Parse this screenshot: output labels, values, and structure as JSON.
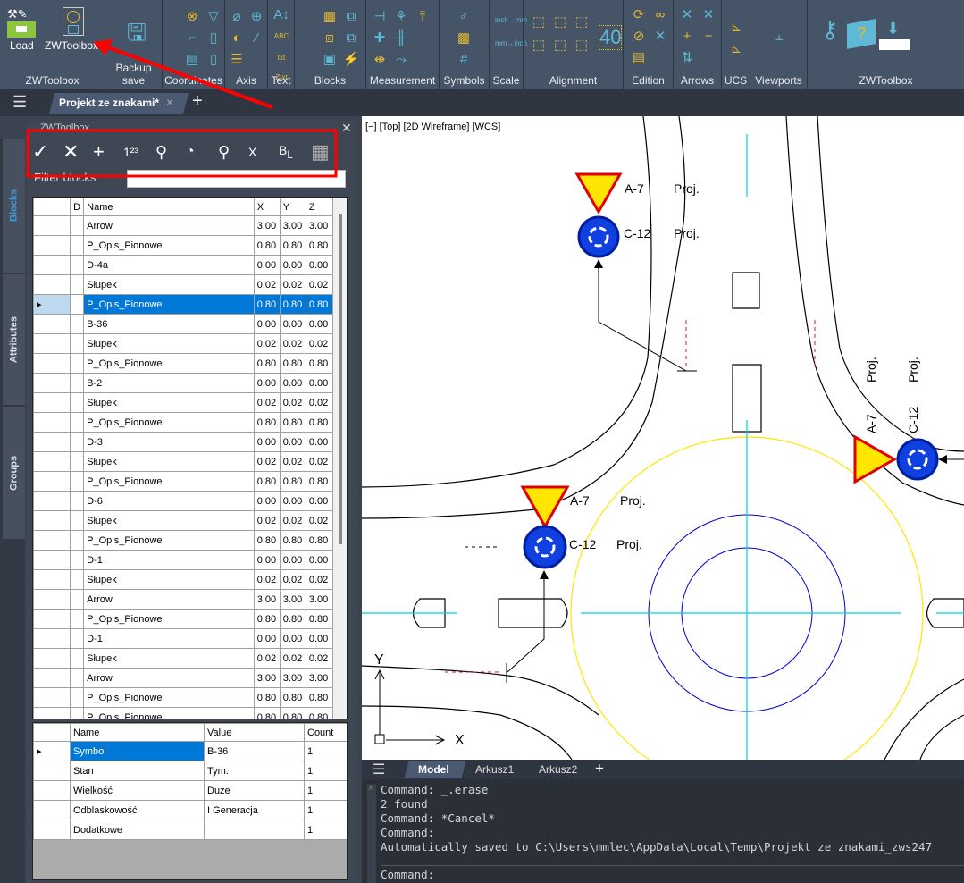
{
  "ribbon": {
    "groups": [
      {
        "label": "ZWToolbox",
        "buttons": [
          "Load",
          "ZWToolbox"
        ]
      },
      {
        "label": "Backup save"
      },
      {
        "label": "Coordinates"
      },
      {
        "label": "Axis"
      },
      {
        "label": "Text"
      },
      {
        "label": "Blocks"
      },
      {
        "label": "Measurement"
      },
      {
        "label": "Symbols"
      },
      {
        "label": "Scale"
      },
      {
        "label": "Alignment"
      },
      {
        "label": "Edition"
      },
      {
        "label": "Arrows"
      },
      {
        "label": "UCS"
      },
      {
        "label": "Viewports"
      },
      {
        "label": "ZWToolbox"
      }
    ],
    "scale_icons": [
      "inch→mm",
      "mm→inch"
    ],
    "text_icons": [
      "ABC",
      "txt Ztxt"
    ],
    "alignment_number": "40"
  },
  "tabs": {
    "document": "Projekt ze znakami*",
    "close": "×",
    "add": "+"
  },
  "toolbox": {
    "title": "ZWToolbox",
    "side_tabs": [
      "Blocks",
      "Attributes",
      "Groups"
    ],
    "toolbar": [
      "check-icon",
      "close-icon",
      "plus-icon",
      "numbering-icon",
      "search-icon",
      "select-icon",
      "zoom-find-icon",
      "x-axis-icon",
      "block-layer-icon",
      "grid-icon"
    ],
    "numbering_label": "1²³",
    "filter_label": "Filter blocks",
    "filter_value": "",
    "blocks": {
      "columns": [
        "D",
        "Name",
        "X",
        "Y",
        "Z"
      ],
      "selected_index": 4,
      "rows": [
        [
          "Arrow",
          "3.00",
          "3.00",
          "3.00"
        ],
        [
          "P_Opis_Pionowe",
          "0.80",
          "0.80",
          "0.80"
        ],
        [
          "D-4a",
          "0.00",
          "0.00",
          "0.00"
        ],
        [
          "Słupek",
          "0.02",
          "0.02",
          "0.02"
        ],
        [
          "P_Opis_Pionowe",
          "0.80",
          "0.80",
          "0.80"
        ],
        [
          "B-36",
          "0.00",
          "0.00",
          "0.00"
        ],
        [
          "Słupek",
          "0.02",
          "0.02",
          "0.02"
        ],
        [
          "P_Opis_Pionowe",
          "0.80",
          "0.80",
          "0.80"
        ],
        [
          "B-2",
          "0.00",
          "0.00",
          "0.00"
        ],
        [
          "Słupek",
          "0.02",
          "0.02",
          "0.02"
        ],
        [
          "P_Opis_Pionowe",
          "0.80",
          "0.80",
          "0.80"
        ],
        [
          "D-3",
          "0.00",
          "0.00",
          "0.00"
        ],
        [
          "Słupek",
          "0.02",
          "0.02",
          "0.02"
        ],
        [
          "P_Opis_Pionowe",
          "0.80",
          "0.80",
          "0.80"
        ],
        [
          "D-6",
          "0.00",
          "0.00",
          "0.00"
        ],
        [
          "Słupek",
          "0.02",
          "0.02",
          "0.02"
        ],
        [
          "P_Opis_Pionowe",
          "0.80",
          "0.80",
          "0.80"
        ],
        [
          "D-1",
          "0.00",
          "0.00",
          "0.00"
        ],
        [
          "Słupek",
          "0.02",
          "0.02",
          "0.02"
        ],
        [
          "Arrow",
          "3.00",
          "3.00",
          "3.00"
        ],
        [
          "P_Opis_Pionowe",
          "0.80",
          "0.80",
          "0.80"
        ],
        [
          "D-1",
          "0.00",
          "0.00",
          "0.00"
        ],
        [
          "Słupek",
          "0.02",
          "0.02",
          "0.02"
        ],
        [
          "Arrow",
          "3.00",
          "3.00",
          "3.00"
        ],
        [
          "P_Opis_Pionowe",
          "0.80",
          "0.80",
          "0.80"
        ],
        [
          "P_Opis_Pionowe",
          "0.80",
          "0.80",
          "0.80"
        ]
      ]
    },
    "attributes": {
      "columns": [
        "Name",
        "Value",
        "Count"
      ],
      "selected_index": 0,
      "rows": [
        [
          "Symbol",
          "B-36",
          "1"
        ],
        [
          "Stan",
          "Tym.",
          "1"
        ],
        [
          "Wielkość",
          "Duże",
          "1"
        ],
        [
          "Odblaskowość",
          "I Generacja",
          "1"
        ],
        [
          "Dodatkowe",
          "",
          "1"
        ]
      ]
    }
  },
  "drawing": {
    "viewport_label": "[−] [Top] [2D Wireframe] [WCS]",
    "sign_a": "A-7",
    "sign_c": "C-12",
    "proj": "Proj.",
    "axis_x": "X",
    "axis_y": "Y"
  },
  "layout_tabs": [
    "Model",
    "Arkusz1",
    "Arkusz2"
  ],
  "command": {
    "lines": [
      "Command: _.erase",
      "2 found",
      "Command: *Cancel*",
      "Command:",
      "Automatically saved to C:\\Users\\mmlec\\AppData\\Local\\Temp\\Projekt ze znakami_zws247"
    ],
    "prompt": "Command:"
  },
  "colors": {
    "ribbon": "#465468",
    "icon_blue": "#5fb8d6",
    "icon_yellow": "#e5b82a",
    "selection": "#0078d7",
    "annotation_red": "#ff0000"
  }
}
